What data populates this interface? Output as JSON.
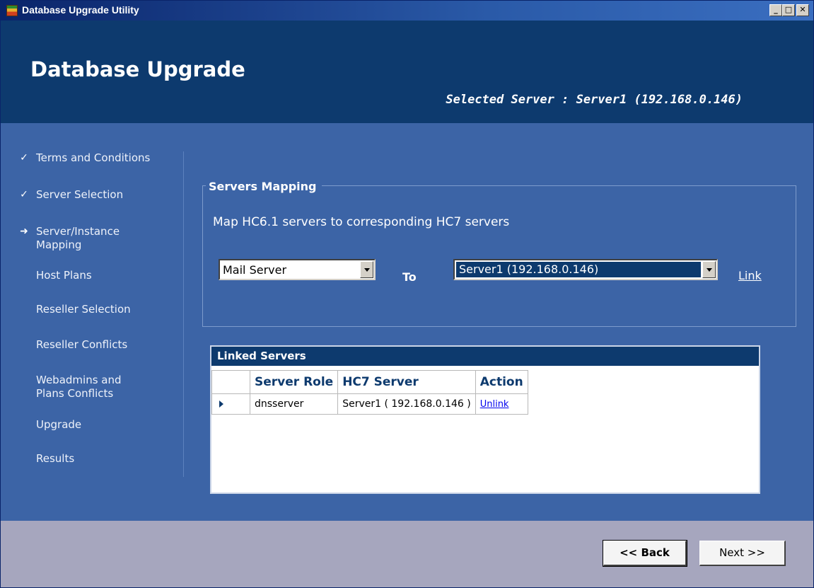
{
  "window": {
    "title": "Database Upgrade Utility",
    "controls": {
      "minimize": "_",
      "maximize": "□",
      "close": "✕"
    }
  },
  "header": {
    "title": "Database Upgrade",
    "selected_server": "Selected Server : Server1 (192.168.0.146)"
  },
  "steps": [
    {
      "label": "Terms and Conditions",
      "status": "done",
      "mark": "✓"
    },
    {
      "label": "Server Selection",
      "status": "done",
      "mark": "✓"
    },
    {
      "label": "Server/Instance\nMapping",
      "status": "current",
      "mark": "➜"
    },
    {
      "label": "Host Plans",
      "status": "pending",
      "mark": ""
    },
    {
      "label": "Reseller Selection",
      "status": "pending",
      "mark": ""
    },
    {
      "label": "Reseller Conflicts",
      "status": "pending",
      "mark": ""
    },
    {
      "label": "Webadmins and\nPlans Conflicts",
      "status": "pending",
      "mark": ""
    },
    {
      "label": "Upgrade",
      "status": "pending",
      "mark": ""
    },
    {
      "label": "Results",
      "status": "pending",
      "mark": ""
    }
  ],
  "mapping": {
    "group_title": "Servers Mapping",
    "description": "Map HC6.1 servers to corresponding HC7 servers",
    "source_value": "Mail Server",
    "to_label": "To",
    "target_value": "Server1 (192.168.0.146)",
    "link_label": "Link"
  },
  "linked": {
    "caption": "Linked Servers",
    "columns": [
      "Server Role",
      "HC7 Server",
      "Action"
    ],
    "rows": [
      {
        "role": "dnsserver",
        "server": "Server1 ( 192.168.0.146 )",
        "action": "Unlink"
      }
    ]
  },
  "footer": {
    "back_label": "<< Back",
    "next_label": "Next >>"
  },
  "colors": {
    "header_bg": "#0d3a6e",
    "main_bg": "#3c64a6",
    "footer_bg": "#a6a6be"
  }
}
